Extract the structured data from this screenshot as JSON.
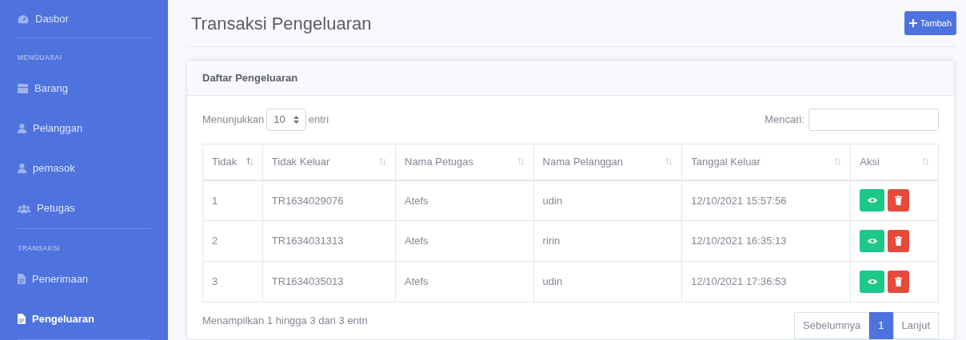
{
  "sidebar": {
    "top_item": {
      "label": "Dasbor",
      "selected": false
    },
    "sections": [
      {
        "heading": "MENGUASAI",
        "items": [
          {
            "label": "Barang",
            "selected": false
          },
          {
            "label": "Pelanggan",
            "selected": false
          },
          {
            "label": "pemasok",
            "selected": false
          },
          {
            "label": "Petugas",
            "selected": false
          }
        ]
      },
      {
        "heading": "TRANSAKSI",
        "items": [
          {
            "label": "Penerimaan",
            "selected": false
          },
          {
            "label": "Pengeluaran",
            "selected": true
          }
        ]
      }
    ]
  },
  "page_title": "Transaksi Pengeluaran",
  "add_button": "Tambah",
  "card": {
    "title": "Daftar Pengeluaran",
    "length_label_before": "Menunjukkan",
    "length_value": "10",
    "length_label_after": "entri",
    "search_label": "Mencari:",
    "table": {
      "columns": [
        {
          "label": "Tidak",
          "sorted": true
        },
        {
          "label": "Tidak Keluar",
          "sorted": false
        },
        {
          "label": "Nama Petugas",
          "sorted": false
        },
        {
          "label": "Nama Pelanggan",
          "sorted": false
        },
        {
          "label": "Tanggal Keluar",
          "sorted": false
        },
        {
          "label": "Aksi",
          "sorted": false
        }
      ],
      "rows": [
        [
          "1",
          "TR1634029076",
          "Atefs",
          "udin",
          "12/10/2021 15:57:56"
        ],
        [
          "2",
          "TR1634031313",
          "Atefs",
          "ririn",
          "12/10/2021 16:35:13"
        ],
        [
          "3",
          "TR1634035013",
          "Atefs",
          "udin",
          "12/10/2021 17:36:53"
        ]
      ]
    },
    "info": "Menampilkan 1 hingga 3 dari 3 entri",
    "pagination": [
      {
        "label": "Sebelumnya",
        "selected": false
      },
      {
        "label": "1",
        "selected": true
      },
      {
        "label": "Lanjut",
        "selected": false
      }
    ]
  }
}
